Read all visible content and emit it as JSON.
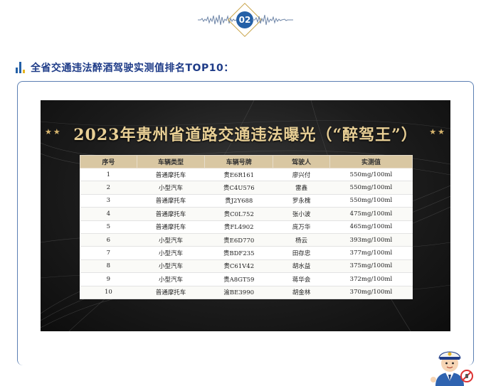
{
  "badge": {
    "number": "02"
  },
  "section": {
    "heading": "全省交通违法醉酒驾驶实测值排名TOP10："
  },
  "poster": {
    "title": "2023年贵州省道路交通违法曝光（“醉驾王”）",
    "stars_left": "★★",
    "stars_right": "★★"
  },
  "table": {
    "headers": [
      "序号",
      "车辆类型",
      "车辆号牌",
      "驾驶人",
      "实测值"
    ],
    "rows": [
      [
        "1",
        "普通摩托车",
        "贵E6R161",
        "廖兴付",
        "550mg/100ml"
      ],
      [
        "2",
        "小型汽车",
        "贵C4U576",
        "雷鑫",
        "550mg/100ml"
      ],
      [
        "3",
        "普通摩托车",
        "贵J2Y688",
        "罗永槐",
        "550mg/100ml"
      ],
      [
        "4",
        "普通摩托车",
        "贵C0L752",
        "张小波",
        "475mg/100ml"
      ],
      [
        "5",
        "普通摩托车",
        "贵FL4902",
        "庞万华",
        "465mg/100ml"
      ],
      [
        "6",
        "小型汽车",
        "贵E6D770",
        "杨云",
        "393mg/100ml"
      ],
      [
        "7",
        "小型汽车",
        "贵BDF235",
        "田存忠",
        "377mg/100ml"
      ],
      [
        "8",
        "小型汽车",
        "贵C61V42",
        "胡水益",
        "375mg/100ml"
      ],
      [
        "9",
        "小型汽车",
        "贵A8GT59",
        "蒋华会",
        "372mg/100ml"
      ],
      [
        "10",
        "普通摩托车",
        "渝BE3990",
        "胡金林",
        "370mg/100ml"
      ]
    ]
  },
  "icons": {
    "badge_decoration": "sound-wave-icon",
    "heading_marker": "bar-chart-icon",
    "mascot": "traffic-police-mascot"
  },
  "colors": {
    "accent_blue": "#2460a7",
    "accent_gold": "#e6b422",
    "title_gold": "#e8cf95",
    "header_tan": "#d9c7a2",
    "box_border": "#5b7fb3"
  }
}
